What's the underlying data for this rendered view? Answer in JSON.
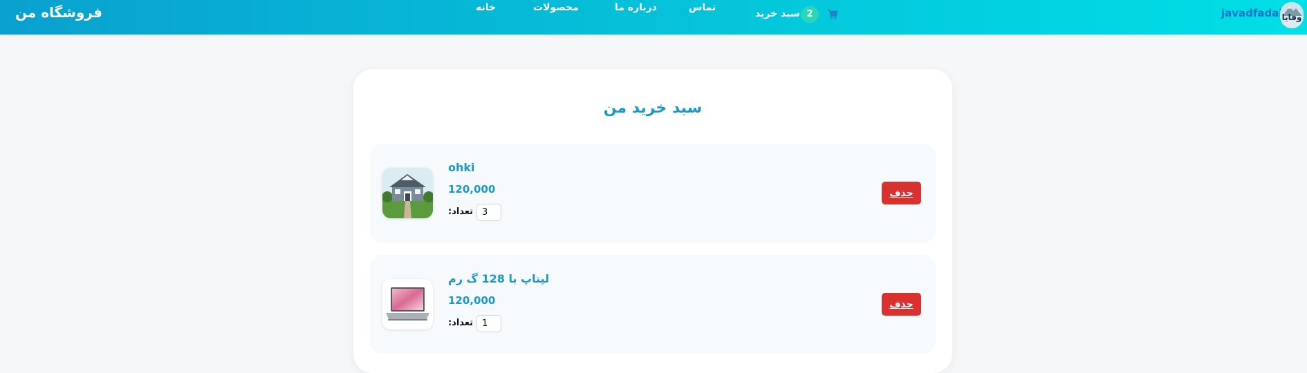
{
  "header": {
    "brand": "فروشگاه من",
    "nav": {
      "home": "خانه",
      "products": "محصولات",
      "about": "درباره ما",
      "contact": "تماس",
      "cart": "سبد خرید"
    },
    "cart_count": "2",
    "username": "javadfadaii",
    "avatar_text": "وفایا"
  },
  "cart": {
    "title": "سبد خرید من",
    "qty_label": "تعداد:",
    "delete_label": "حذف",
    "items": [
      {
        "name": "ohki",
        "price": "120,000",
        "quantity": "3",
        "image": "house-photo"
      },
      {
        "name": "لپتاپ با 128 گ رم",
        "price": "120,000",
        "quantity": "1",
        "image": "laptop-photo"
      }
    ]
  },
  "colors": {
    "accent": "#1a98c7",
    "header_start": "#0aa0cf",
    "header_end": "#00dfe6",
    "danger": "#d8312f",
    "badge": "#28d7b8"
  }
}
